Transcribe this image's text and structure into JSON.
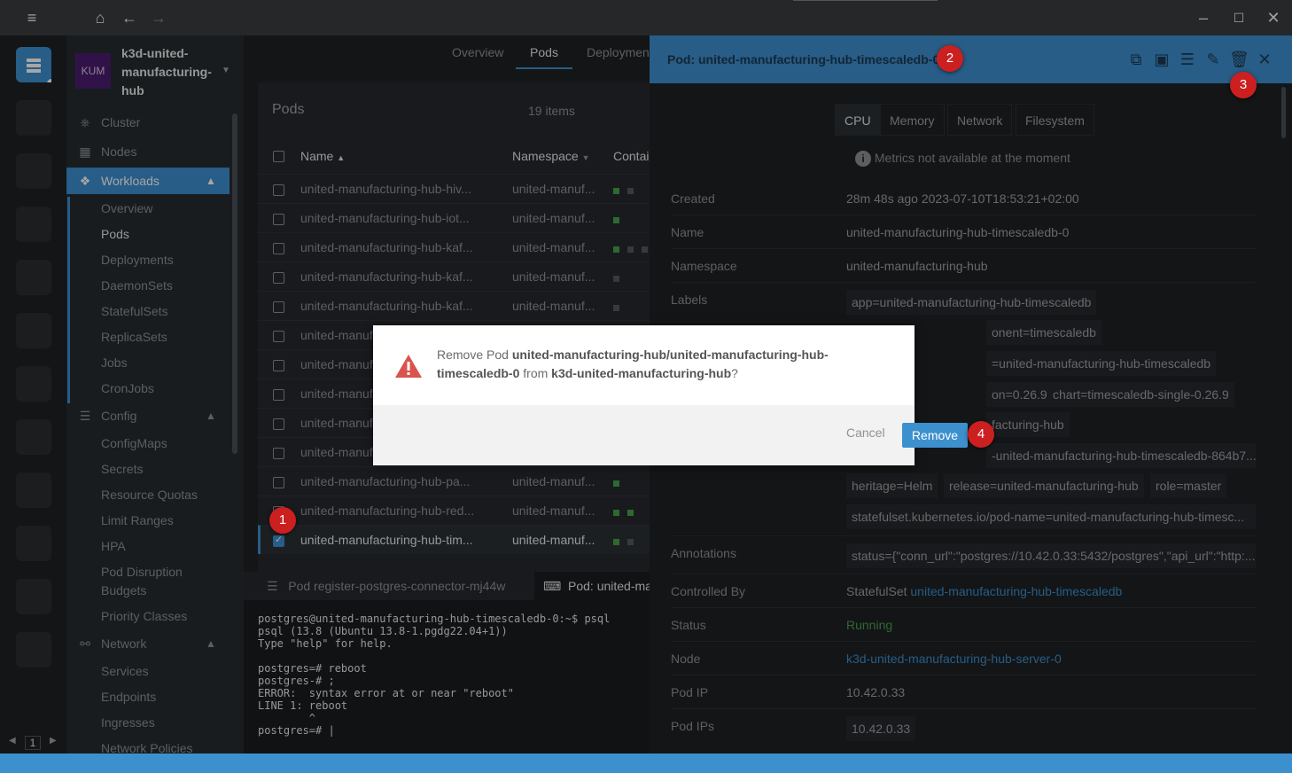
{
  "titlebar": {
    "menu_icon": "menu-icon",
    "home_icon": "home-icon",
    "back_icon": "arrow-left-icon",
    "forward_icon": "arrow-right-icon"
  },
  "cluster": {
    "badge": "KUM",
    "name": "k3d-united-manufacturing-hub"
  },
  "hotbar": {
    "page": "1"
  },
  "nav": {
    "cluster": "Cluster",
    "nodes": "Nodes",
    "workloads": "Workloads",
    "workload_items": [
      "Overview",
      "Pods",
      "Deployments",
      "DaemonSets",
      "StatefulSets",
      "ReplicaSets",
      "Jobs",
      "CronJobs"
    ],
    "config": "Config",
    "config_items": [
      "ConfigMaps",
      "Secrets",
      "Resource Quotas",
      "Limit Ranges",
      "HPA",
      "Pod Disruption Budgets",
      "Priority Classes"
    ],
    "network": "Network",
    "network_items": [
      "Services",
      "Endpoints",
      "Ingresses",
      "Network Policies"
    ]
  },
  "tabs": [
    "Overview",
    "Pods",
    "Deploymen"
  ],
  "pods": {
    "title": "Pods",
    "count": "19 items",
    "columns": [
      "Name",
      "Namespace",
      "Contai"
    ],
    "rows": [
      {
        "name": "united-manufacturing-hub-hiv...",
        "ns": "united-manuf..."
      },
      {
        "name": "united-manufacturing-hub-iot...",
        "ns": "united-manuf..."
      },
      {
        "name": "united-manufacturing-hub-kaf...",
        "ns": "united-manuf..."
      },
      {
        "name": "united-manufacturing-hub-kaf...",
        "ns": "united-manuf..."
      },
      {
        "name": "united-manufacturing-hub-kaf...",
        "ns": "united-manuf..."
      },
      {
        "name": "united-manuf",
        "ns": ""
      },
      {
        "name": "united-manuf",
        "ns": ""
      },
      {
        "name": "united-manuf",
        "ns": ""
      },
      {
        "name": "united-manuf",
        "ns": ""
      },
      {
        "name": "united-manuf",
        "ns": ""
      },
      {
        "name": "united-manufacturing-hub-pa...",
        "ns": "united-manuf..."
      },
      {
        "name": "united-manufacturing-hub-red...",
        "ns": "united-manuf..."
      },
      {
        "name": "united-manufacturing-hub-tim...",
        "ns": "united-manuf..."
      }
    ]
  },
  "dock": {
    "tab1": "Pod register-postgres-connector-mj44w",
    "tab2": "Pod: united-ma",
    "terminal": "postgres@united-manufacturing-hub-timescaledb-0:~$ psql\npsql (13.8 (Ubuntu 13.8-1.pgdg22.04+1))\nType \"help\" for help.\n\npostgres=# reboot\npostgres-# ;\nERROR:  syntax error at or near \"reboot\"\nLINE 1: reboot\n        ^\npostgres=# |"
  },
  "panel": {
    "title": "Pod: united-manufacturing-hub-timescaledb-0",
    "metric_tabs": [
      "CPU",
      "Memory",
      "Network",
      "Filesystem"
    ],
    "metrics_msg": "Metrics not available at the moment",
    "labels": {
      "created": "Created",
      "name": "Name",
      "namespace": "Namespace",
      "labels": "Labels",
      "annotations": "Annotations",
      "controlled_by": "Controlled By",
      "status": "Status",
      "node": "Node",
      "pod_ip": "Pod IP",
      "pod_ips": "Pod IPs"
    },
    "created": "28m 48s ago 2023-07-10T18:53:21+02:00",
    "name": "united-manufacturing-hub-timescaledb-0",
    "namespace": "united-manufacturing-hub",
    "label_chips": [
      "app=united-manufacturing-hub-timescaledb",
      "onent=timescaledb",
      "=united-manufacturing-hub-timescaledb",
      "on=0.26.9",
      "chart=timescaledb-single-0.26.9",
      "facturing-hub",
      "-united-manufacturing-hub-timescaledb-864b7...",
      "heritage=Helm",
      "release=united-manufacturing-hub",
      "role=master",
      "statefulset.kubernetes.io/pod-name=united-manufacturing-hub-timesc..."
    ],
    "annotation": "status={\"conn_url\":\"postgres://10.42.0.33:5432/postgres\",\"api_url\":\"http:...",
    "controlled_by_kind": "StatefulSet",
    "controlled_by_link": "united-manufacturing-hub-timescaledb",
    "status": "Running",
    "node": "k3d-united-manufacturing-hub-server-0",
    "pod_ip": "10.42.0.33",
    "pod_ips": "10.42.0.33"
  },
  "dialog": {
    "prefix": "Remove Pod ",
    "target": "united-manufacturing-hub/united-manufacturing-hub-timescaledb-0",
    "mid": " from ",
    "cluster": "k3d-united-manufacturing-hub",
    "suffix": "?",
    "cancel": "Cancel",
    "remove": "Remove"
  },
  "markers": [
    "1",
    "2",
    "3",
    "4"
  ],
  "colors": {
    "accent": "#3d90ce",
    "ok": "#48a14a",
    "danger": "#cc1f1f"
  }
}
